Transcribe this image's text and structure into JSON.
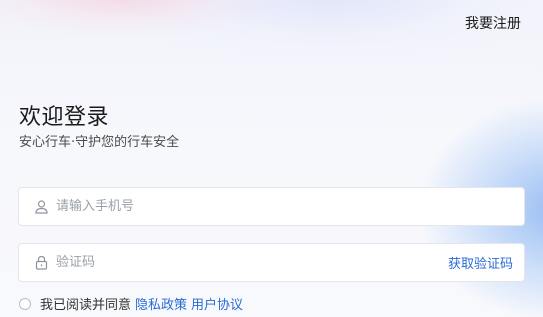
{
  "header": {
    "register_label": "我要注册"
  },
  "welcome": {
    "title": "欢迎登录",
    "subtitle": "安心行车·守护您的行车安全"
  },
  "phone_field": {
    "placeholder": "请输入手机号",
    "value": "",
    "icon": "user-icon"
  },
  "code_field": {
    "placeholder": "验证码",
    "value": "",
    "icon": "lock-icon",
    "get_code_label": "获取验证码"
  },
  "agreement": {
    "checked": false,
    "text": "我已阅读并同意",
    "privacy_link": "隐私政策",
    "terms_link": "用户协议"
  },
  "colors": {
    "link": "#2a6ad4",
    "text": "#1a1a1a",
    "placeholder": "#9aa0a8"
  }
}
